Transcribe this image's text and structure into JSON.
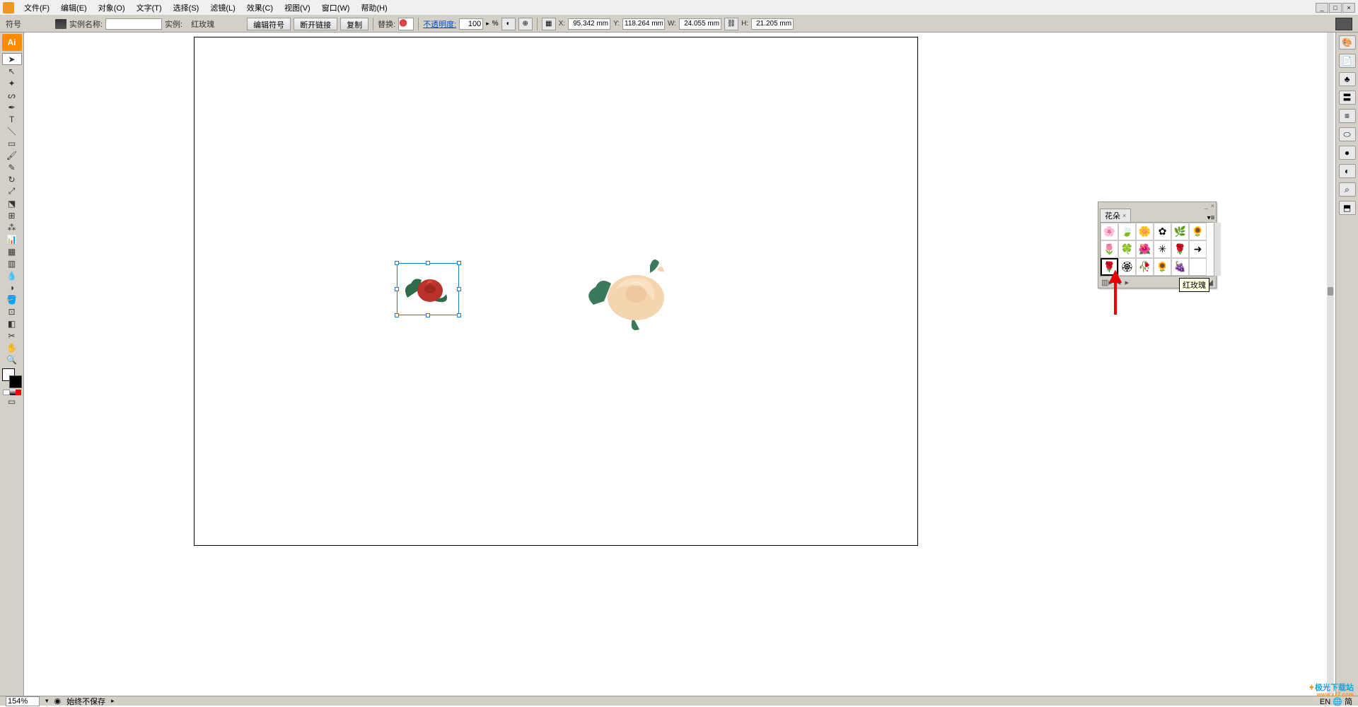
{
  "menu": {
    "file": "文件(F)",
    "edit": "编辑(E)",
    "object": "对象(O)",
    "text": "文字(T)",
    "select": "选择(S)",
    "filter": "滤镜(L)",
    "effect": "效果(C)",
    "view": "视图(V)",
    "window": "窗口(W)",
    "help": "帮助(H)"
  },
  "window_controls": {
    "min": "_",
    "max": "□",
    "close": "×"
  },
  "controlbar": {
    "mode_label": "符号",
    "instance_label": "实例名称:",
    "instance_value": "",
    "inst_prefix": "实例:",
    "symbol_name": "红玫瑰",
    "btn_edit": "编辑符号",
    "btn_break": "断开链接",
    "btn_dup": "复制",
    "replace_label": "替换:",
    "opacity_label": "不透明度:",
    "opacity_value": "100",
    "opacity_unit": "%",
    "x_label": "X:",
    "x_value": "95.342 mm",
    "y_label": "Y:",
    "y_value": "118.264 mm",
    "w_label": "W:",
    "w_value": "24.055 mm",
    "h_label": "H:",
    "h_value": "21.205 mm"
  },
  "panel": {
    "title": "花朵",
    "tooltip": "红玫瑰",
    "symbols": [
      "🌸",
      "🍃",
      "🌼",
      "✿",
      "🌿",
      "🌻",
      "🌷",
      "🍀",
      "🌺",
      "✳",
      "🌹",
      "➜",
      "🌹",
      "🏵",
      "🥀",
      "🌻",
      "🍇",
      ""
    ],
    "selected_index": 12
  },
  "status": {
    "zoom": "154%",
    "save_state": "始终不保存",
    "ime": "EN 🌐 简"
  },
  "watermark": {
    "brand": "极光下载站",
    "url": "www.xz7.com"
  },
  "dock_icons": [
    "🎨",
    "📄",
    "♣",
    "〓",
    "≡",
    "⬭",
    "●",
    "◐",
    "⌕",
    "⬒"
  ]
}
